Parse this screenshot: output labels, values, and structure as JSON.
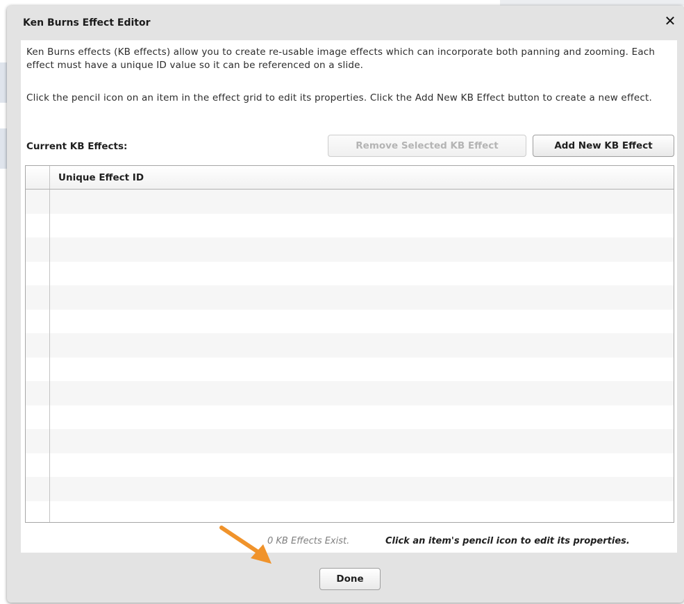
{
  "dialog": {
    "title": "Ken Burns Effect Editor",
    "close_icon": "close-icon",
    "intro_paragraph_1": "Ken Burns effects (KB effects) allow you to create re-usable image effects which can incorporate both panning and zooming.  Each effect must have a unique ID value so it can be referenced on a slide.",
    "intro_paragraph_2": "Click the pencil icon on an item in the effect grid to edit its properties.  Click the Add New KB Effect button to create a new effect.",
    "current_label": "Current KB Effects:",
    "remove_button": "Remove Selected KB Effect",
    "add_button": "Add New KB Effect",
    "done_button": "Done"
  },
  "grid": {
    "columns": [
      "Unique Effect ID"
    ],
    "rows": []
  },
  "status": {
    "count_text": "0 KB Effects Exist.",
    "hint_text": "Click an item's pencil icon to edit its properties."
  },
  "colors": {
    "annotation_arrow": "#f0932b",
    "dialog_background": "#e3e3e3",
    "row_stripe": "#f6f6f6"
  }
}
